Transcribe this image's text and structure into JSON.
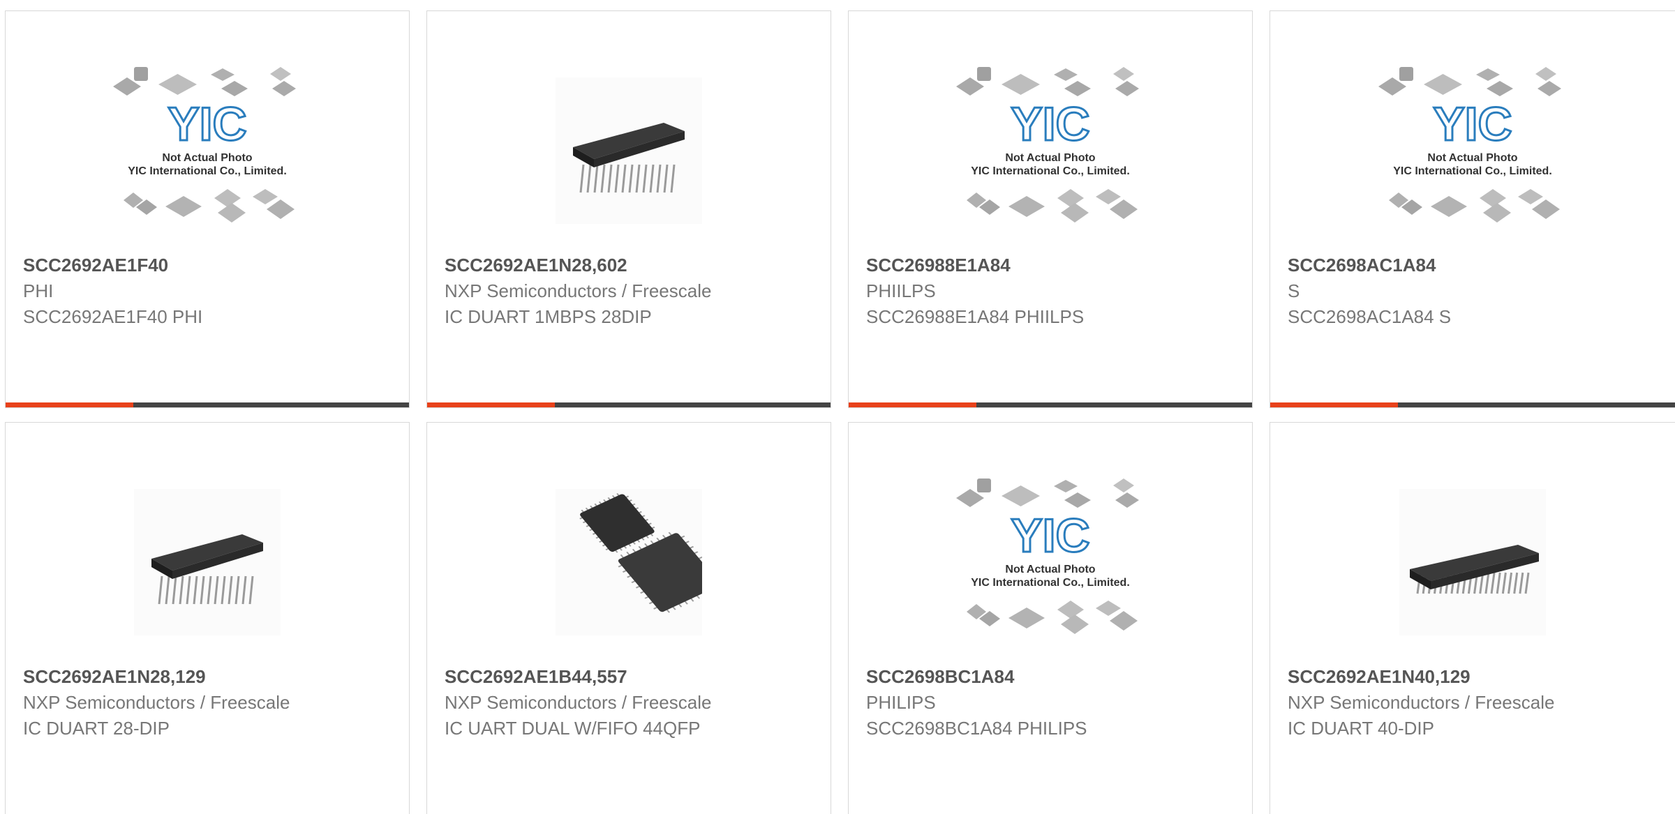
{
  "placeholder": {
    "line1": "Not Actual Photo",
    "line2": "YIC International Co., Limited.",
    "logo": "YIC"
  },
  "colors": {
    "accent": "#e8411a",
    "bar": "#444444",
    "border": "#d8d8d8",
    "title": "#555555",
    "text": "#777777",
    "logo": "#2a7dbd"
  },
  "products": [
    {
      "part": "SCC2692AE1F40",
      "manufacturer": "PHI",
      "description": "SCC2692AE1F40 PHI",
      "image": "placeholder-logo"
    },
    {
      "part": "SCC2692AE1N28,602",
      "manufacturer": "NXP Semiconductors / Freescale",
      "description": "IC DUART 1MBPS 28DIP",
      "image": "dip-chip"
    },
    {
      "part": "SCC26988E1A84",
      "manufacturer": "PHIILPS",
      "description": "SCC26988E1A84 PHIILPS",
      "image": "placeholder-logo"
    },
    {
      "part": "SCC2698AC1A84",
      "manufacturer": "S",
      "description": "SCC2698AC1A84 S",
      "image": "placeholder-logo"
    },
    {
      "part": "SCC2692AE1N28,129",
      "manufacturer": "NXP Semiconductors / Freescale",
      "description": "IC DUART 28-DIP",
      "image": "dip-chip"
    },
    {
      "part": "SCC2692AE1B44,557",
      "manufacturer": "NXP Semiconductors / Freescale",
      "description": "IC UART DUAL W/FIFO 44QFP",
      "image": "qfp-chip"
    },
    {
      "part": "SCC2698BC1A84",
      "manufacturer": "PHILIPS",
      "description": "SCC2698BC1A84 PHILIPS",
      "image": "placeholder-logo"
    },
    {
      "part": "SCC2692AE1N40,129",
      "manufacturer": "NXP Semiconductors / Freescale",
      "description": "IC DUART 40-DIP",
      "image": "dip-long-chip"
    }
  ]
}
